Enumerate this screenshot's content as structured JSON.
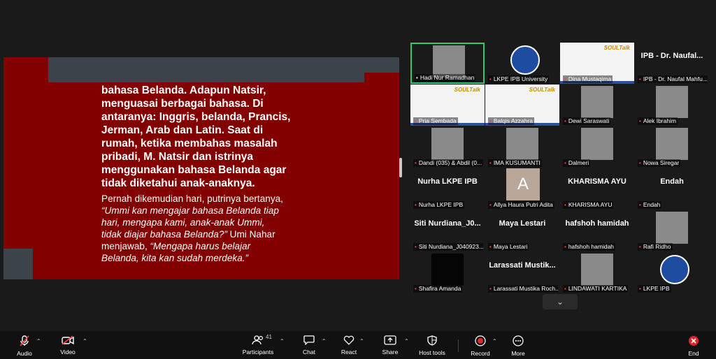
{
  "slide": {
    "bold_lines": [
      "bahasa Belanda. Adapun Natsir,",
      "menguasai berbagai bahasa. Di",
      "antaranya: Inggris, belanda, Prancis,",
      "Jerman, Arab dan Latin. Saat di",
      "rumah, ketika membahas masalah",
      "pribadi, M. Natsir dan istrinya",
      "menggunakan bahasa Belanda agar",
      "tidak diketahui anak-anaknya."
    ],
    "para_line1": "Pernah dikemudian hari, putrinya bertanya,",
    "para_italic1": "“Ummi kan mengajar bahasa Belanda tiap",
    "para_italic2": "hari, mengapa kami, anak-anak Ummi,",
    "para_italic3": "tidak diajar bahasa Belanda?”",
    "para_tail3": " Umi Nahar",
    "para_line5": "menjawab, ",
    "para_italic5": "“Mengapa harus belajar",
    "para_italic6": "Belanda, kita kan sudah merdeka.”"
  },
  "participants": [
    {
      "name": "Hadi Nur Ramadhan",
      "big": "",
      "kind": "photo"
    },
    {
      "name": "LKPE IPB University",
      "big": "",
      "kind": "ipb"
    },
    {
      "name": "Dina Mustaqima",
      "big": "",
      "kind": "slide"
    },
    {
      "name": "IPB - Dr. Naufal Mahfu...",
      "big": "IPB - Dr. Naufal...",
      "kind": "name"
    },
    {
      "name": "Pria Sembada",
      "big": "",
      "kind": "slide"
    },
    {
      "name": "Balqis Azzahra",
      "big": "",
      "kind": "slide"
    },
    {
      "name": "Dewi Saraswati",
      "big": "",
      "kind": "photo"
    },
    {
      "name": "Alek Ibrahim",
      "big": "",
      "kind": "photo"
    },
    {
      "name": "Dandi (035) & Abdil (0...",
      "big": "",
      "kind": "photo"
    },
    {
      "name": "IMA KUSUMANTI",
      "big": "",
      "kind": "photo"
    },
    {
      "name": "Dalmeri",
      "big": "",
      "kind": "photo"
    },
    {
      "name": "Nowa Siregar",
      "big": "",
      "kind": "photo"
    },
    {
      "name": "Nurha LKPE IPB",
      "big": "Nurha LKPE IPB",
      "kind": "name"
    },
    {
      "name": "Allya Haura Putri Adita",
      "big": "A",
      "kind": "letter"
    },
    {
      "name": "KHARISMA AYU",
      "big": "KHARISMA AYU",
      "kind": "name"
    },
    {
      "name": "Endah",
      "big": "Endah",
      "kind": "name"
    },
    {
      "name": "Siti Nurdiana_J040923...",
      "big": "Siti Nurdiana_J0...",
      "kind": "name"
    },
    {
      "name": "Maya Lestari",
      "big": "Maya Lestari",
      "kind": "name"
    },
    {
      "name": "hafshoh hamidah",
      "big": "hafshoh hamidah",
      "kind": "name"
    },
    {
      "name": "Rafi Ridho",
      "big": "",
      "kind": "photo"
    },
    {
      "name": "Shafira Amanda",
      "big": "",
      "kind": "dark"
    },
    {
      "name": "Larassati Mustika Roch...",
      "big": "Larassati Mustik...",
      "kind": "name"
    },
    {
      "name": "LINDAWATI KARTIKA",
      "big": "",
      "kind": "photo"
    },
    {
      "name": "LKPE IPB",
      "big": "",
      "kind": "ipb"
    }
  ],
  "slide_thumb_logo": "SOULTalk",
  "toolbar": {
    "audio": "Audio",
    "video": "Video",
    "participants": "Participants",
    "participants_count": "41",
    "chat": "Chat",
    "react": "React",
    "share": "Share",
    "host_tools": "Host tools",
    "record": "Record",
    "more": "More",
    "end": "End"
  },
  "colors": {
    "slide_bg": "#820000",
    "active_speaker": "#2ecc71",
    "muted": "#ff4040"
  }
}
